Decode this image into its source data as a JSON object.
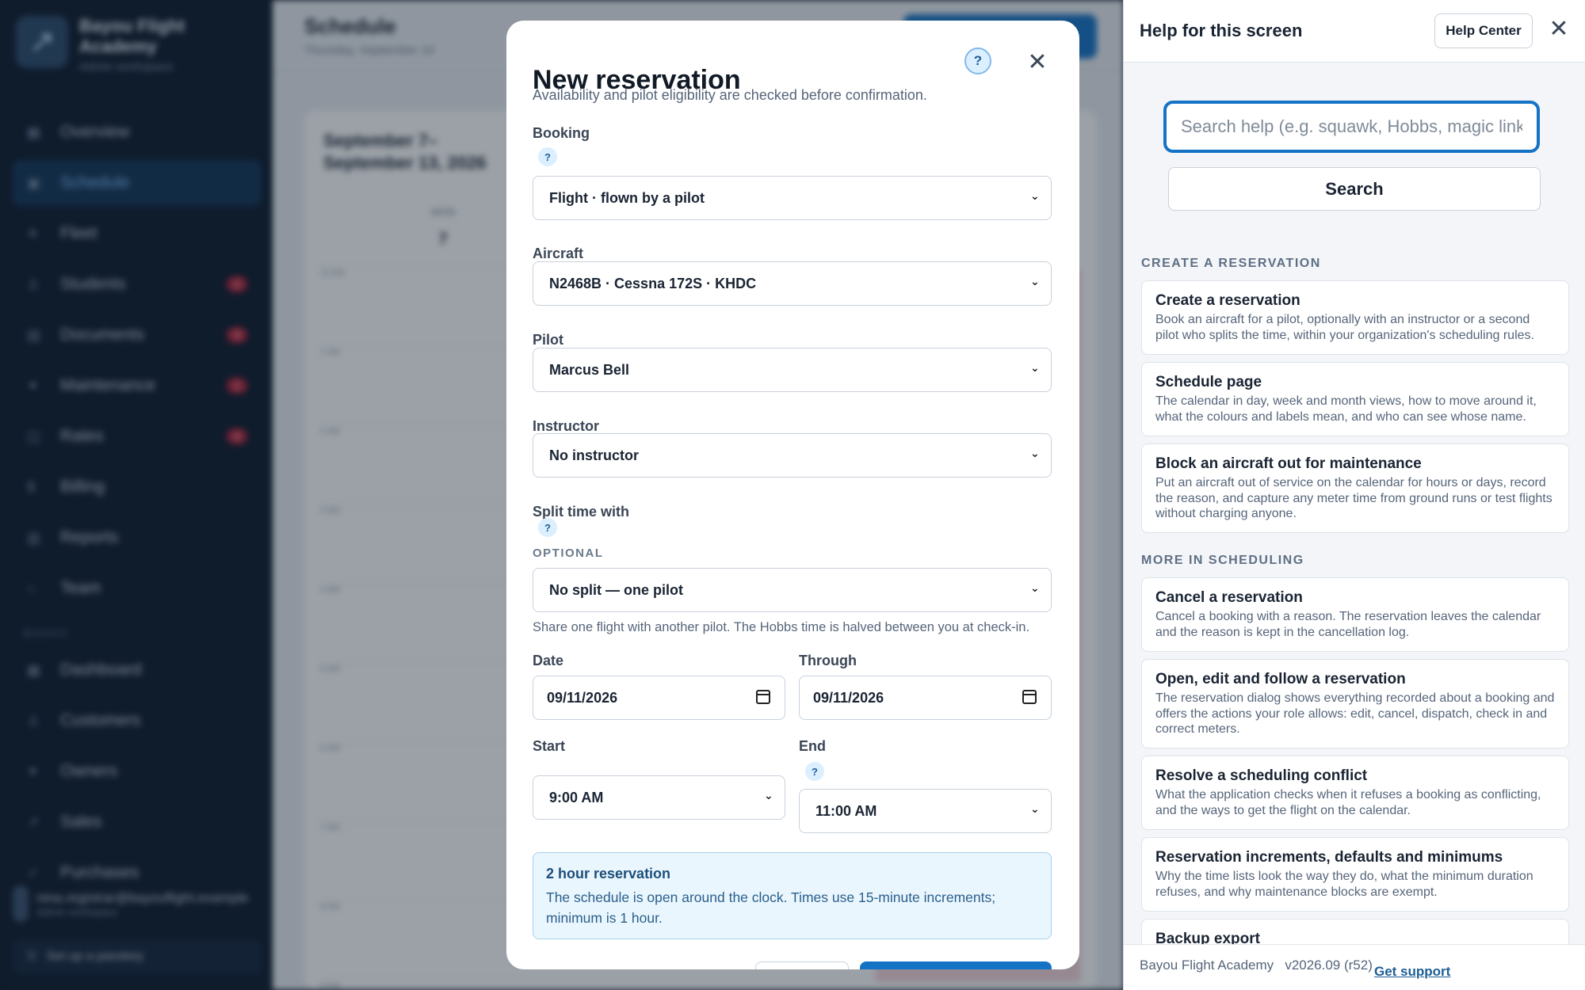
{
  "app": {
    "brand_name": "Bayou Flight Academy",
    "brand_sub": "Admin workspace",
    "nav": [
      {
        "label": "Overview",
        "icon": "grid-icon"
      },
      {
        "label": "Schedule",
        "icon": "calendar-icon",
        "active": true
      },
      {
        "label": "Fleet",
        "icon": "plane-icon"
      },
      {
        "label": "Students",
        "icon": "person-icon",
        "badge": "2"
      },
      {
        "label": "Documents",
        "icon": "document-icon",
        "badge": "3"
      },
      {
        "label": "Maintenance",
        "icon": "wrench-icon",
        "badge": "1"
      },
      {
        "label": "Rates",
        "icon": "tag-icon",
        "badge": "4"
      },
      {
        "label": "Billing",
        "icon": "dollar-icon"
      },
      {
        "label": "Reports",
        "icon": "chart-icon"
      },
      {
        "label": "Team",
        "icon": "team-icon"
      }
    ],
    "section_label": "BOOKS",
    "nav_books": [
      {
        "label": "Dashboard",
        "icon": "grid-icon"
      },
      {
        "label": "Customers",
        "icon": "person-icon"
      },
      {
        "label": "Owners",
        "icon": "star-icon"
      },
      {
        "label": "Sales",
        "icon": "trend-icon"
      },
      {
        "label": "Purchases",
        "icon": "check-icon"
      }
    ],
    "user_email": "nina.registrar@bayouflight.example",
    "user_role": "Admin workspace",
    "passkey_label": "Set up a passkey",
    "page_title": "Schedule",
    "page_sub": "Thursday, September 10",
    "cal_range": "September 7–\nSeptember 13, 2026",
    "cal_day_name": "MON",
    "cal_day_num": "7",
    "hours": [
      "12 AM",
      "1 AM",
      "2 AM",
      "3 AM",
      "4 AM",
      "5 AM",
      "6 AM",
      "7 AM",
      "8 AM",
      "9 AM"
    ]
  },
  "modal": {
    "title": "New reservation",
    "description": "Availability and pilot eligibility are checked before confirmation.",
    "help_glyph": "?",
    "close_glyph": "✕",
    "booking": {
      "label": "Booking",
      "value": "Flight · flown by a pilot"
    },
    "aircraft": {
      "label": "Aircraft",
      "value": "N2468B · Cessna 172S · KHDC"
    },
    "pilot": {
      "label": "Pilot",
      "value": "Marcus Bell"
    },
    "instructor": {
      "label": "Instructor",
      "value": "No instructor"
    },
    "split": {
      "label": "Split time with",
      "optional": "OPTIONAL",
      "value": "No split — one pilot",
      "hint": "Share one flight with another pilot. The Hobbs time is halved between you at check-in."
    },
    "date": {
      "label": "Date",
      "value": "09/11/2026"
    },
    "through": {
      "label": "Through",
      "value": "09/11/2026"
    },
    "start": {
      "label": "Start",
      "value": "9:00 AM"
    },
    "end": {
      "label": "End",
      "value": "11:00 AM"
    },
    "info": {
      "title": "2 hour reservation",
      "body": "The schedule is open around the clock. Times use 15-minute increments; minimum is 1 hour."
    }
  },
  "help": {
    "title": "Help for this screen",
    "help_center": "Help Center",
    "close_glyph": "✕",
    "search_placeholder": "Search help (e.g. squawk, Hobbs, magic link)",
    "search_button": "Search",
    "section1": "CREATE A RESERVATION",
    "section2": "MORE IN SCHEDULING",
    "cards1": [
      {
        "title": "Create a reservation",
        "body": "Book an aircraft for a pilot, optionally with an instructor or a second pilot who splits the time, within your organization's scheduling rules."
      },
      {
        "title": "Schedule page",
        "body": "The calendar in day, week and month views, how to move around it, what the colours and labels mean, and who can see whose name."
      },
      {
        "title": "Block an aircraft out for maintenance",
        "body": "Put an aircraft out of service on the calendar for hours or days, record the reason, and capture any meter time from ground runs or test flights without charging anyone."
      }
    ],
    "cards2": [
      {
        "title": "Cancel a reservation",
        "body": "Cancel a booking with a reason. The reservation leaves the calendar and the reason is kept in the cancellation log."
      },
      {
        "title": "Open, edit and follow a reservation",
        "body": "The reservation dialog shows everything recorded about a booking and offers the actions your role allows: edit, cancel, dispatch, check in and correct meters."
      },
      {
        "title": "Resolve a scheduling conflict",
        "body": "What the application checks when it refuses a booking as conflicting, and the ways to get the flight on the calendar."
      },
      {
        "title": "Reservation increments, defaults and minimums",
        "body": "Why the time lists look the way they do, what the minimum duration refuses, and why maintenance blocks are exempt."
      },
      {
        "title": "Backup export",
        "body": ""
      }
    ],
    "footer_text": "Bayou Flight Academy   v2026.09 (r52)",
    "footer_link": "Get support"
  }
}
